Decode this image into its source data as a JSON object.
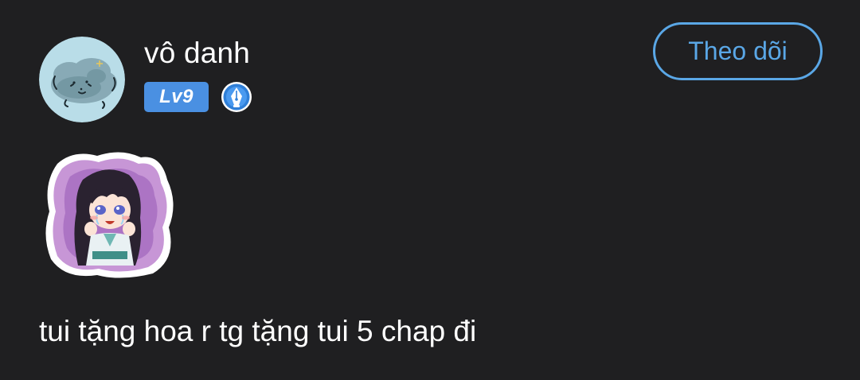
{
  "comment": {
    "author": {
      "name": "vô danh",
      "level_label": "Lv9",
      "avatar_icon": "cloud-doodle-avatar",
      "badge_icon": "pen-nib-icon"
    },
    "follow_label": "Theo dõi",
    "sticker_icon": "crying-anime-girl-sticker",
    "text": "tui tặng hoa r tg tặng tui 5 chap đi"
  },
  "colors": {
    "background": "#1f1f21",
    "text": "#ffffff",
    "accent": "#5aa7e6",
    "level_badge": "#4a90e2",
    "avatar_bg": "#b9dde8"
  }
}
